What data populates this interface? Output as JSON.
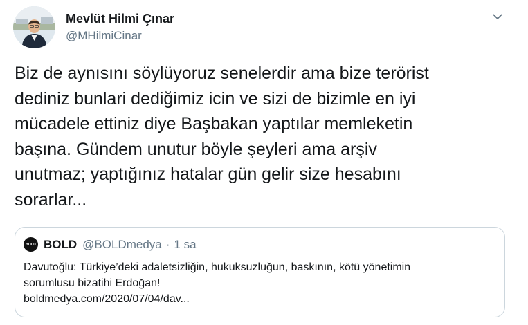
{
  "author": {
    "name": "Mevlüt Hilmi Çınar",
    "handle": "@MHilmiCinar"
  },
  "icons": {
    "menu": "chevron-down-icon",
    "avatar": "profile-photo"
  },
  "tweet": {
    "text": "Biz de aynısını söylüyoruz senelerdir ama bize terörist\ndediniz bunlari dediğimiz icin ve sizi de bizimle en iyi\nmücadele ettiniz diye Başbakan yaptılar memleketin\nbaşına. Gündem unutur böyle şeyleri ama arşiv\nunutmaz; yaptığınız hatalar gün gelir size hesabını\nsorarlar..."
  },
  "quote": {
    "logo_text": "BOLD",
    "name": "BOLD",
    "handle": "@BOLDmedya",
    "separator": "·",
    "time": "1 sa",
    "text": "Davutoğlu: Türkiye’deki adaletsizliğin, hukuksuzluğun, baskının, kötü yönetimin\nsorumlusu bizatihi Erdoğan!\nboldmedya.com/2020/07/04/dav..."
  },
  "colors": {
    "text": "#14171a",
    "secondary": "#657786",
    "border": "#ccd6dd",
    "background": "#ffffff"
  }
}
